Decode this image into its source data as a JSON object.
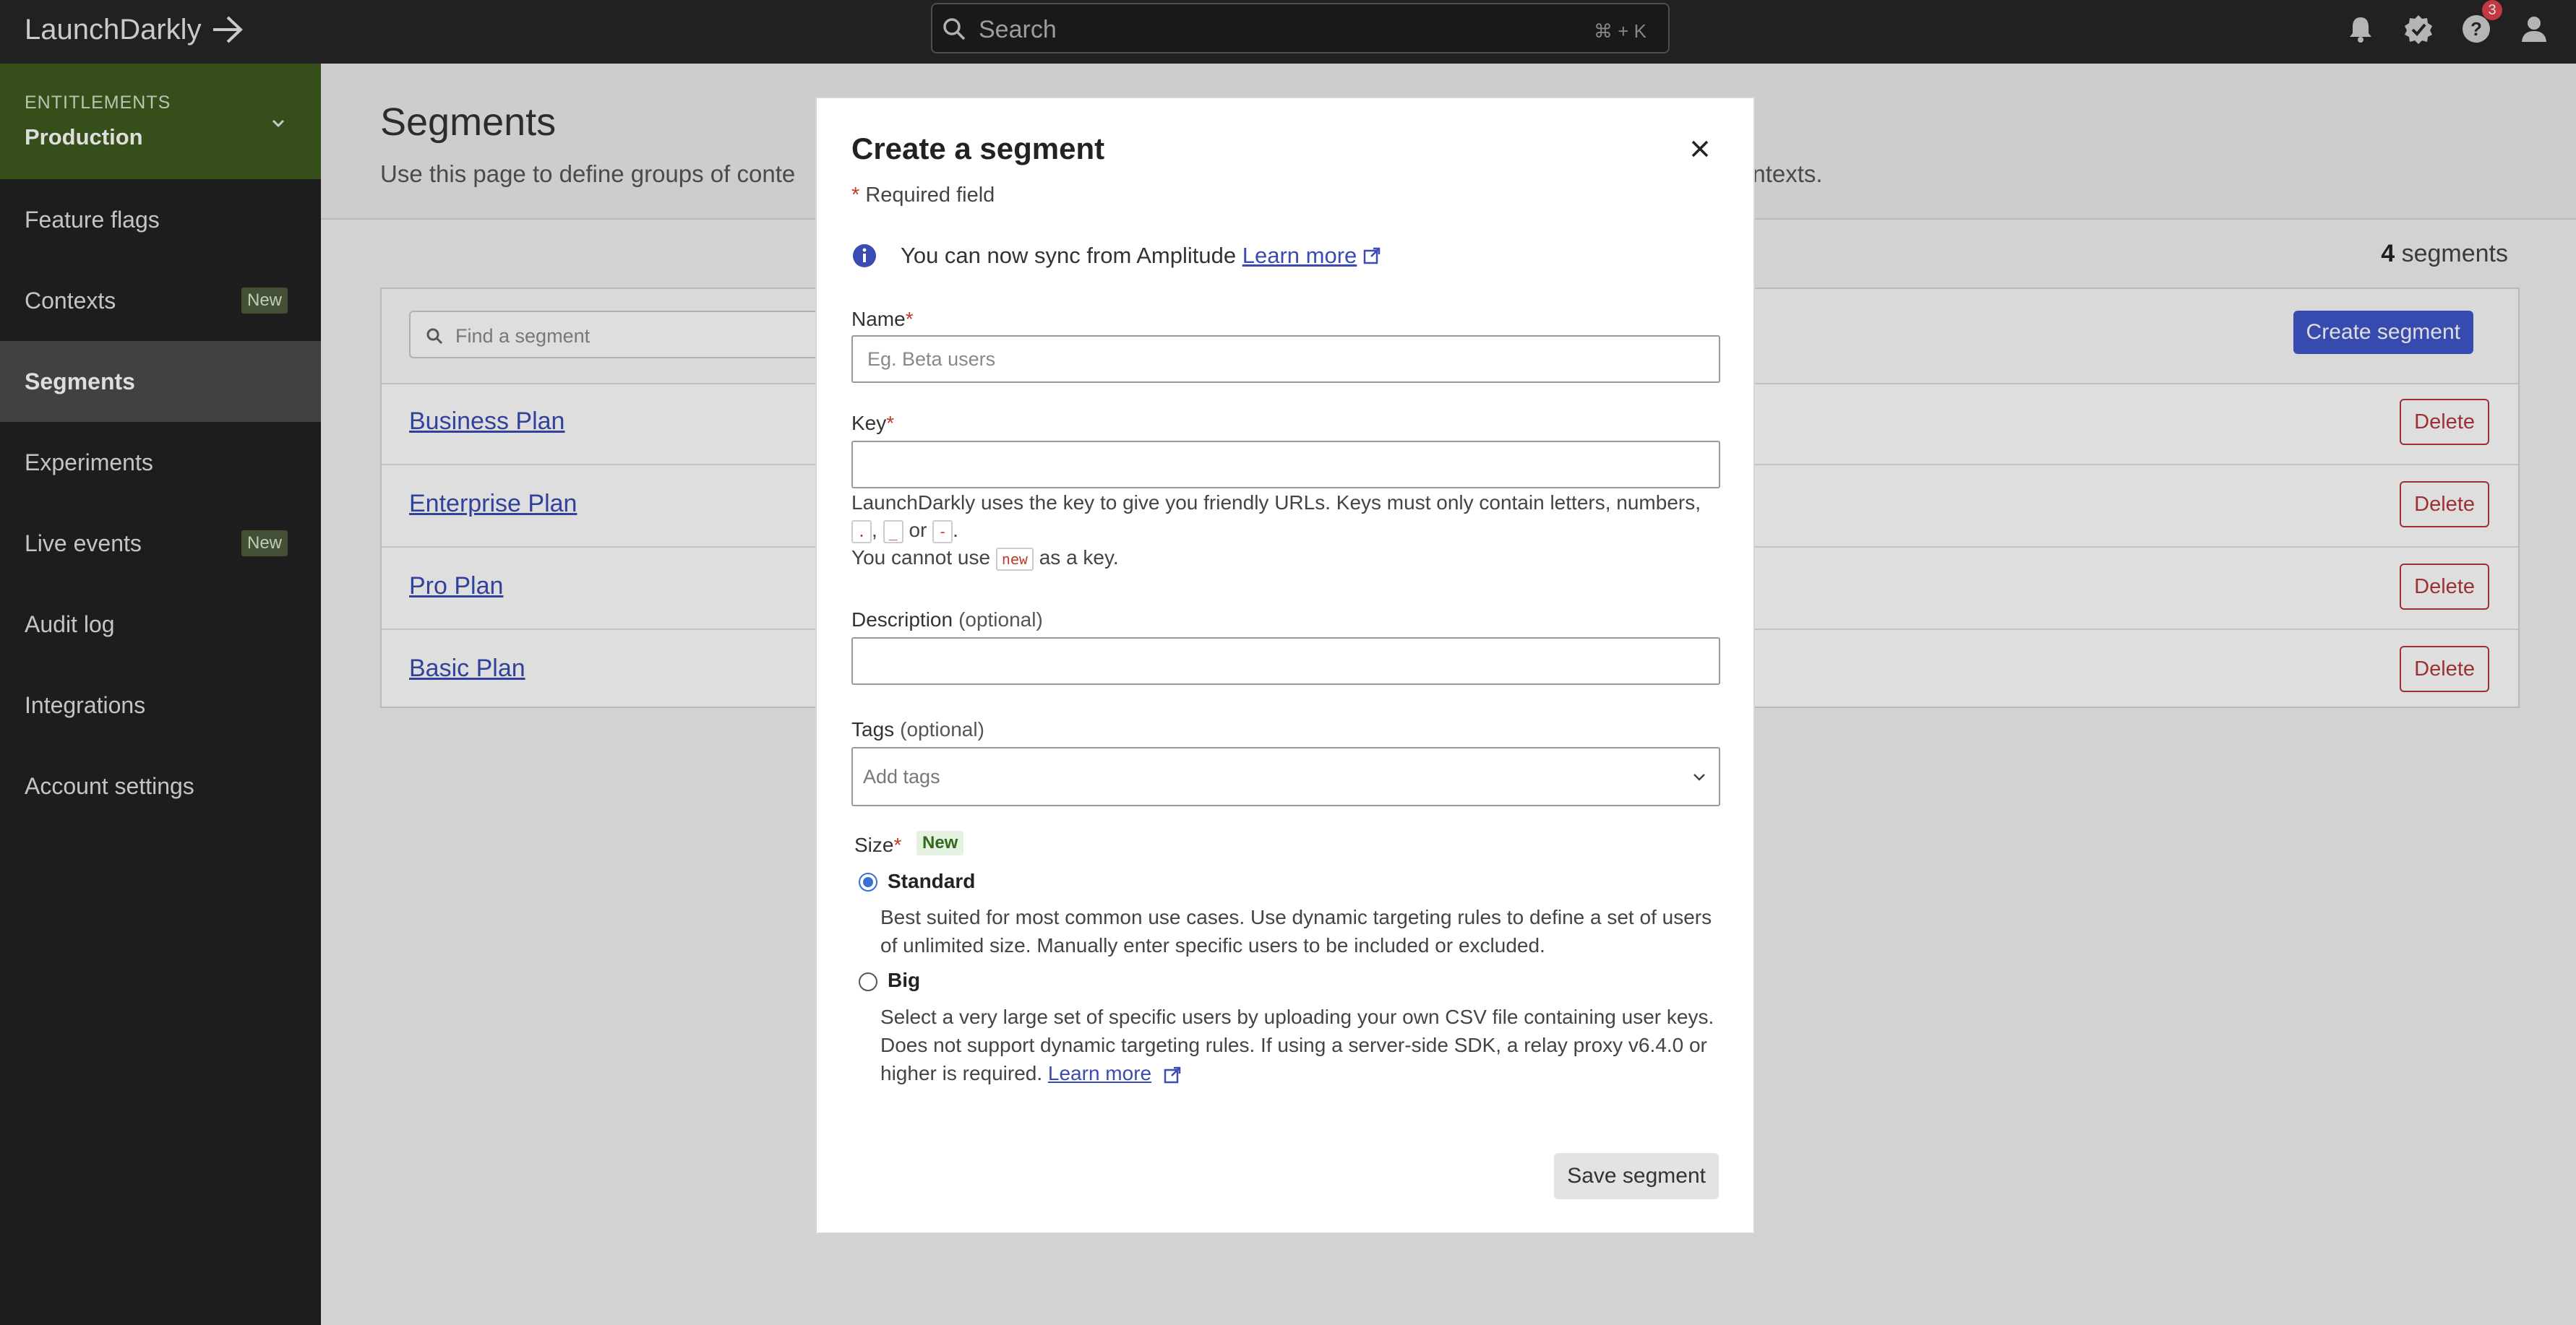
{
  "app": {
    "name": "LaunchDarkly"
  },
  "search": {
    "placeholder": "Search",
    "shortcut": "⌘ + K"
  },
  "header": {
    "notification_badge": "3"
  },
  "sidebar": {
    "environment": {
      "label": "ENTITLEMENTS",
      "name": "Production"
    },
    "items": [
      {
        "label": "Feature flags",
        "badge": ""
      },
      {
        "label": "Contexts",
        "badge": "New"
      },
      {
        "label": "Segments",
        "badge": ""
      },
      {
        "label": "Experiments",
        "badge": ""
      },
      {
        "label": "Live events",
        "badge": "New"
      },
      {
        "label": "Audit log",
        "badge": ""
      },
      {
        "label": "Integrations",
        "badge": ""
      },
      {
        "label": "Account settings",
        "badge": ""
      }
    ]
  },
  "page": {
    "title": "Segments",
    "description_start": "Use this page to define groups of conte",
    "description_end": "ontexts.",
    "count_number": "4",
    "count_label": "segments",
    "find_placeholder": "Find a segment",
    "create_button": "Create segment",
    "delete_label": "Delete",
    "segments": [
      "Business Plan",
      "Enterprise Plan",
      "Pro Plan",
      "Basic Plan"
    ]
  },
  "modal": {
    "title": "Create a segment",
    "required_star": "*",
    "required_note": "Required field",
    "info_text": "You can now sync from Amplitude",
    "info_link": "Learn more",
    "name_label": "Name",
    "name_placeholder": "Eg. Beta users",
    "key_label": "Key",
    "key_help_1": "LaunchDarkly uses the key to give you friendly URLs. Keys must only contain letters, numbers,",
    "key_chars": [
      ".",
      "_",
      "-"
    ],
    "key_help_or": "or",
    "key_help_3a": "You cannot use",
    "key_reserved": "new",
    "key_help_3b": "as a key.",
    "description_label": "Description",
    "optional": "(optional)",
    "tags_label": "Tags",
    "tags_placeholder": "Add tags",
    "size_label": "Size",
    "size_badge": "New",
    "standard_label": "Standard",
    "standard_desc": "Best suited for most common use cases. Use dynamic targeting rules to define a set of users of unlimited size. Manually enter specific users to be included or excluded.",
    "big_label": "Big",
    "big_desc": "Select a very large set of specific users by uploading your own CSV file containing user keys. Does not support dynamic targeting rules. If using a server-side SDK, a relay proxy v6.4.0 or higher is required.",
    "big_link": "Learn more",
    "save_button": "Save segment"
  },
  "colors": {
    "accent": "#4055c9",
    "danger": "#b5383c",
    "env_bg": "#3d5a1e",
    "sidebar_bg": "#222222"
  }
}
